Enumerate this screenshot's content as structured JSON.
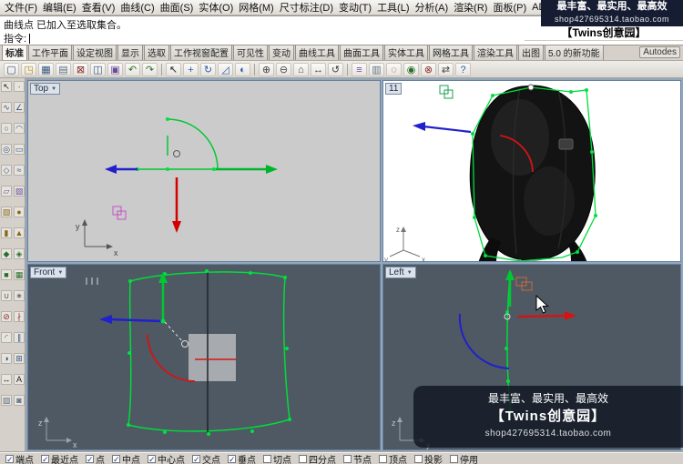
{
  "menu": {
    "items": [
      {
        "name": "menu-file",
        "label": "文件(F)"
      },
      {
        "name": "menu-edit",
        "label": "编辑(E)"
      },
      {
        "name": "menu-view",
        "label": "查看(V)"
      },
      {
        "name": "menu-curve",
        "label": "曲线(C)"
      },
      {
        "name": "menu-surface",
        "label": "曲面(S)"
      },
      {
        "name": "menu-solid",
        "label": "实体(O)"
      },
      {
        "name": "menu-mesh",
        "label": "网格(M)"
      },
      {
        "name": "menu-dimension",
        "label": "尺寸标注(D)"
      },
      {
        "name": "menu-transform",
        "label": "变动(T)"
      },
      {
        "name": "menu-tools",
        "label": "工具(L)"
      },
      {
        "name": "menu-analyze",
        "label": "分析(A)"
      },
      {
        "name": "menu-render",
        "label": "渲染(R)"
      },
      {
        "name": "menu-panels",
        "label": "面板(P)"
      },
      {
        "name": "menu-ad-sha",
        "label": "AD Sha"
      }
    ]
  },
  "promo": {
    "line1": "最丰富、最实用、最高效",
    "line2": "shop427695314.taobao.com",
    "line3": "【Twins创意园】"
  },
  "command": {
    "history": "曲线点 已加入至选取集合。",
    "prompt": "指令:"
  },
  "tab_bar": {
    "tabs": [
      {
        "name": "tab-standard",
        "label": "标准",
        "active": true
      },
      {
        "name": "tab-cplanes",
        "label": "工作平面",
        "active": false
      },
      {
        "name": "tab-set-view",
        "label": "设定视图",
        "active": false
      },
      {
        "name": "tab-display",
        "label": "显示",
        "active": false
      },
      {
        "name": "tab-select",
        "label": "选取",
        "active": false
      },
      {
        "name": "tab-viewport-layout",
        "label": "工作视窗配置",
        "active": false
      },
      {
        "name": "tab-visibility",
        "label": "可见性",
        "active": false
      },
      {
        "name": "tab-transform",
        "label": "变动",
        "active": false
      },
      {
        "name": "tab-curve-tools",
        "label": "曲线工具",
        "active": false
      },
      {
        "name": "tab-surface-tools",
        "label": "曲面工具",
        "active": false
      },
      {
        "name": "tab-solid-tools",
        "label": "实体工具",
        "active": false
      },
      {
        "name": "tab-mesh-tools",
        "label": "网格工具",
        "active": false
      },
      {
        "name": "tab-render-tools",
        "label": "渲染工具",
        "active": false
      },
      {
        "name": "tab-drafting",
        "label": "出图",
        "active": false
      },
      {
        "name": "tab-new-in-v5",
        "label": "5.0 的新功能",
        "active": false
      }
    ],
    "right_label": "Autodes"
  },
  "toolbar": {
    "icons": [
      {
        "name": "new-file-icon",
        "glyph": "▢",
        "color": "#33557f"
      },
      {
        "name": "open-file-icon",
        "glyph": "◳",
        "color": "#b08b1a"
      },
      {
        "name": "save-icon",
        "glyph": "▦",
        "color": "#33557f"
      },
      {
        "name": "print-icon",
        "glyph": "▤",
        "color": "#607080"
      },
      {
        "name": "cut-icon",
        "glyph": "⊠",
        "color": "#8a2b2b"
      },
      {
        "name": "copy-icon",
        "glyph": "◫",
        "color": "#33557f"
      },
      {
        "name": "paste-icon",
        "glyph": "▣",
        "color": "#6a4a9a"
      },
      {
        "name": "undo-icon",
        "glyph": "↶",
        "color": "#2b6e2b"
      },
      {
        "name": "redo-icon",
        "glyph": "↷",
        "color": "#2b6e2b"
      },
      {
        "sep": true
      },
      {
        "name": "select-icon",
        "glyph": "↖",
        "color": "#222222"
      },
      {
        "name": "move-icon",
        "glyph": "+",
        "color": "#2b5fa8"
      },
      {
        "name": "rotate-icon",
        "glyph": "↻",
        "color": "#2b5fa8"
      },
      {
        "name": "scale-icon",
        "glyph": "◿",
        "color": "#2b5fa8"
      },
      {
        "name": "mirror-icon",
        "glyph": "◐",
        "color": "#2b5fa8"
      },
      {
        "sep": true
      },
      {
        "name": "zoom-in-icon",
        "glyph": "⊕",
        "color": "#444444"
      },
      {
        "name": "zoom-out-icon",
        "glyph": "⊖",
        "color": "#444444"
      },
      {
        "name": "zoom-extents-icon",
        "glyph": "⌂",
        "color": "#444444"
      },
      {
        "name": "pan-icon",
        "glyph": "↔",
        "color": "#444444"
      },
      {
        "name": "rotate-view-icon",
        "glyph": "↺",
        "color": "#444444"
      },
      {
        "sep": true
      },
      {
        "name": "layers-icon",
        "glyph": "≡",
        "color": "#6a4a9a"
      },
      {
        "name": "properties-icon",
        "glyph": "▥",
        "color": "#607080"
      },
      {
        "name": "hide-icon",
        "glyph": "◌",
        "color": "#8a2b2b"
      },
      {
        "name": "show-icon",
        "glyph": "◉",
        "color": "#2b6e2b"
      },
      {
        "name": "delete-icon",
        "glyph": "⊗",
        "color": "#8a2b2b"
      },
      {
        "name": "swap-view-icon",
        "glyph": "⇄",
        "color": "#444444"
      },
      {
        "name": "help-icon",
        "glyph": "?",
        "color": "#2b5fa8"
      }
    ]
  },
  "sidebar": {
    "icons": [
      {
        "name": "select-tool-icon",
        "glyph": "↖",
        "color": "#1a1a1a"
      },
      {
        "name": "point-tool-icon",
        "glyph": "∙",
        "color": "#1a1a1a"
      },
      {
        "name": "curve-tool-icon",
        "glyph": "∿",
        "color": "#33557f"
      },
      {
        "name": "polyline-tool-icon",
        "glyph": "∠",
        "color": "#33557f"
      },
      {
        "name": "circle-tool-icon",
        "glyph": "○",
        "color": "#33557f"
      },
      {
        "name": "arc-tool-icon",
        "glyph": "◠",
        "color": "#33557f"
      },
      {
        "name": "ellipse-tool-icon",
        "glyph": "◎",
        "color": "#33557f"
      },
      {
        "name": "rectangle-tool-icon",
        "glyph": "▭",
        "color": "#33557f"
      },
      {
        "name": "polygon-tool-icon",
        "glyph": "◇",
        "color": "#33557f"
      },
      {
        "name": "freeform-tool-icon",
        "glyph": "≈",
        "color": "#33557f"
      },
      {
        "name": "surface-tool-icon",
        "glyph": "▱",
        "color": "#6a4a9a"
      },
      {
        "name": "surface-corner-tool-icon",
        "glyph": "▨",
        "color": "#6a4a9a"
      },
      {
        "name": "box-tool-icon",
        "glyph": "▧",
        "color": "#8a6a1a"
      },
      {
        "name": "sphere-tool-icon",
        "glyph": "●",
        "color": "#8a6a1a"
      },
      {
        "name": "cylinder-tool-icon",
        "glyph": "▮",
        "color": "#8a6a1a"
      },
      {
        "name": "cone-tool-icon",
        "glyph": "▲",
        "color": "#8a6a1a"
      },
      {
        "name": "curve-tools-icon",
        "glyph": "◆",
        "color": "#2b6e2b"
      },
      {
        "name": "surface-tools-icon",
        "glyph": "◈",
        "color": "#2b6e2b"
      },
      {
        "name": "solid-tools-icon",
        "glyph": "■",
        "color": "#2b6e2b"
      },
      {
        "name": "mesh-tools-icon",
        "glyph": "▦",
        "color": "#2b6e2b"
      },
      {
        "name": "join-tool-icon",
        "glyph": "∪",
        "color": "#555555"
      },
      {
        "name": "explode-tool-icon",
        "glyph": "∗",
        "color": "#555555"
      },
      {
        "name": "trim-tool-icon",
        "glyph": "⊘",
        "color": "#8a2b2b"
      },
      {
        "name": "split-tool-icon",
        "glyph": "∤",
        "color": "#8a2b2b"
      },
      {
        "name": "fillet-tool-icon",
        "glyph": "◜",
        "color": "#33557f"
      },
      {
        "name": "offset-tool-icon",
        "glyph": "∥",
        "color": "#33557f"
      },
      {
        "name": "mirror-tool-icon",
        "glyph": "◑",
        "color": "#33557f"
      },
      {
        "name": "array-tool-icon",
        "glyph": "⊞",
        "color": "#33557f"
      },
      {
        "name": "dimension-tool-icon",
        "glyph": "↔",
        "color": "#1a1a1a"
      },
      {
        "name": "text-tool-icon",
        "glyph": "A",
        "color": "#1a1a1a"
      },
      {
        "name": "hatch-tool-icon",
        "glyph": "▨",
        "color": "#607080"
      },
      {
        "name": "render-tool-icon",
        "glyph": "◙",
        "color": "#607080"
      }
    ]
  },
  "viewports": {
    "top": {
      "label": "Top",
      "axis_v": "y",
      "axis_h": "x"
    },
    "perspective": {
      "label": "11",
      "axis_v": "z",
      "axis_h": "x",
      "axis_d": "y"
    },
    "front": {
      "label": "Front",
      "axis_v": "z",
      "axis_h": "x"
    },
    "left": {
      "label": "Left",
      "axis_v": "z",
      "axis_h": "y"
    }
  },
  "watermark": {
    "line1": "最丰富、最实用、最高效",
    "line2": "【Twins创意园】",
    "line3": "shop427695314.taobao.com"
  },
  "status_bar": {
    "osnaps": [
      {
        "name": "osnap-endpoint",
        "label": "端点",
        "checked": true
      },
      {
        "name": "osnap-nearest",
        "label": "最近点",
        "checked": true
      },
      {
        "name": "osnap-point",
        "label": "点",
        "checked": true
      },
      {
        "name": "osnap-midpoint",
        "label": "中点",
        "checked": true
      },
      {
        "name": "osnap-center",
        "label": "中心点",
        "checked": true
      },
      {
        "name": "osnap-intersection",
        "label": "交点",
        "checked": true
      },
      {
        "name": "osnap-perpendicular",
        "label": "垂点",
        "checked": true
      },
      {
        "name": "osnap-tangent",
        "label": "切点",
        "checked": false
      },
      {
        "name": "osnap-quadrant",
        "label": "四分点",
        "checked": false
      },
      {
        "name": "osnap-knot",
        "label": "节点",
        "checked": false
      },
      {
        "name": "osnap-vertex",
        "label": "顶点",
        "checked": false
      },
      {
        "name": "osnap-project",
        "label": "投影",
        "checked": false
      },
      {
        "name": "osnap-disable",
        "label": "停用",
        "checked": false
      }
    ]
  },
  "ui": {
    "dropdown_arrow": "▼",
    "check_glyph": "✓"
  },
  "colors": {
    "accent_green": "#00dc3c",
    "accent_red": "#d41414",
    "accent_blue": "#2020cc",
    "viewport_dark": "#4e5963",
    "viewport_gray": "#cbcbcb",
    "promo_bg": "#161d33"
  }
}
